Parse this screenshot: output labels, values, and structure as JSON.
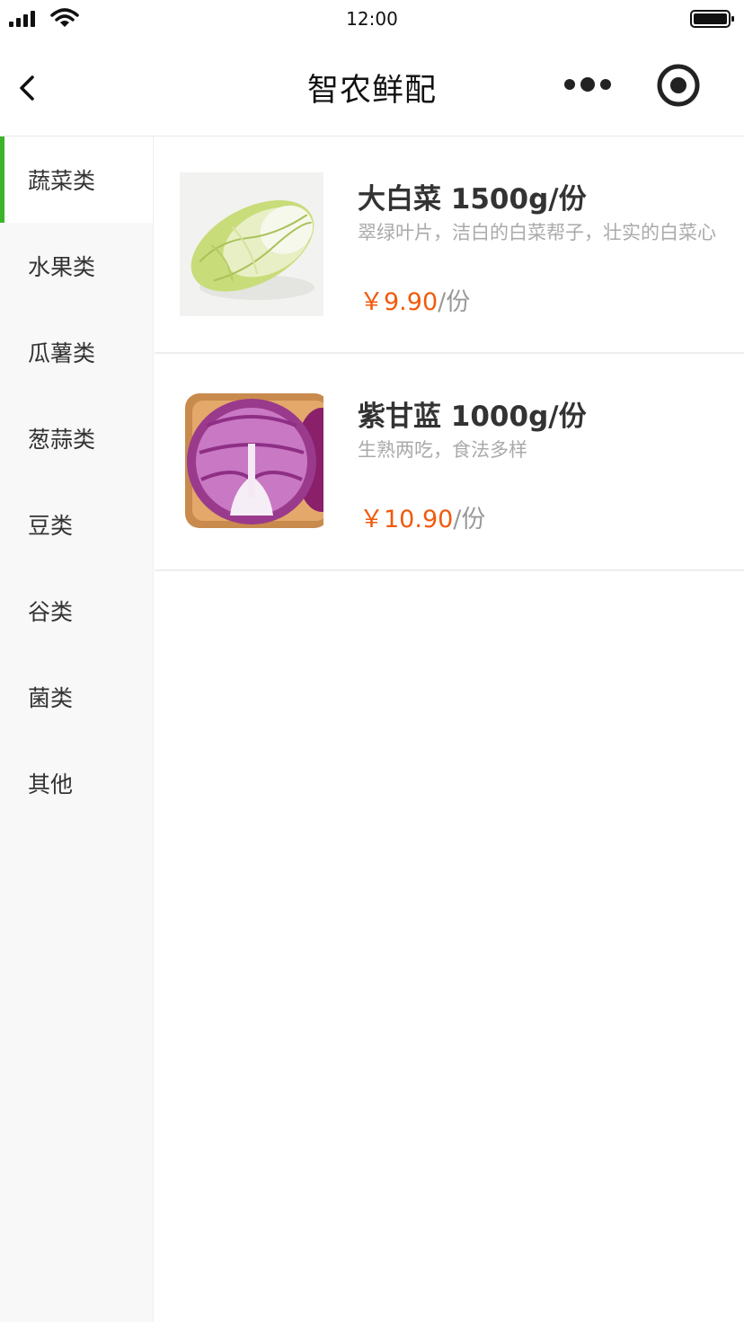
{
  "status_bar": {
    "time": "12:00"
  },
  "header": {
    "title": "智农鲜配"
  },
  "sidebar": {
    "items": [
      {
        "label": "蔬菜类",
        "active": true
      },
      {
        "label": "水果类",
        "active": false
      },
      {
        "label": "瓜薯类",
        "active": false
      },
      {
        "label": "葱蒜类",
        "active": false
      },
      {
        "label": "豆类",
        "active": false
      },
      {
        "label": "谷类",
        "active": false
      },
      {
        "label": "菌类",
        "active": false
      },
      {
        "label": "其他",
        "active": false
      }
    ]
  },
  "products": [
    {
      "name": "大白菜 1500g/份",
      "description": "翠绿叶片，洁白的白菜帮子，壮实的白菜心",
      "currency": "￥",
      "price": "9.90",
      "unit": "/份",
      "image_icon": "napa-cabbage-image"
    },
    {
      "name": "紫甘蓝 1000g/份",
      "description": "生熟两吃，食法多样",
      "currency": "￥",
      "price": "10.90",
      "unit": "/份",
      "image_icon": "red-cabbage-image"
    }
  ],
  "colors": {
    "accent": "#3bb42a",
    "price": "#f15a0c",
    "sidebar_bg": "#f8f8f8"
  }
}
